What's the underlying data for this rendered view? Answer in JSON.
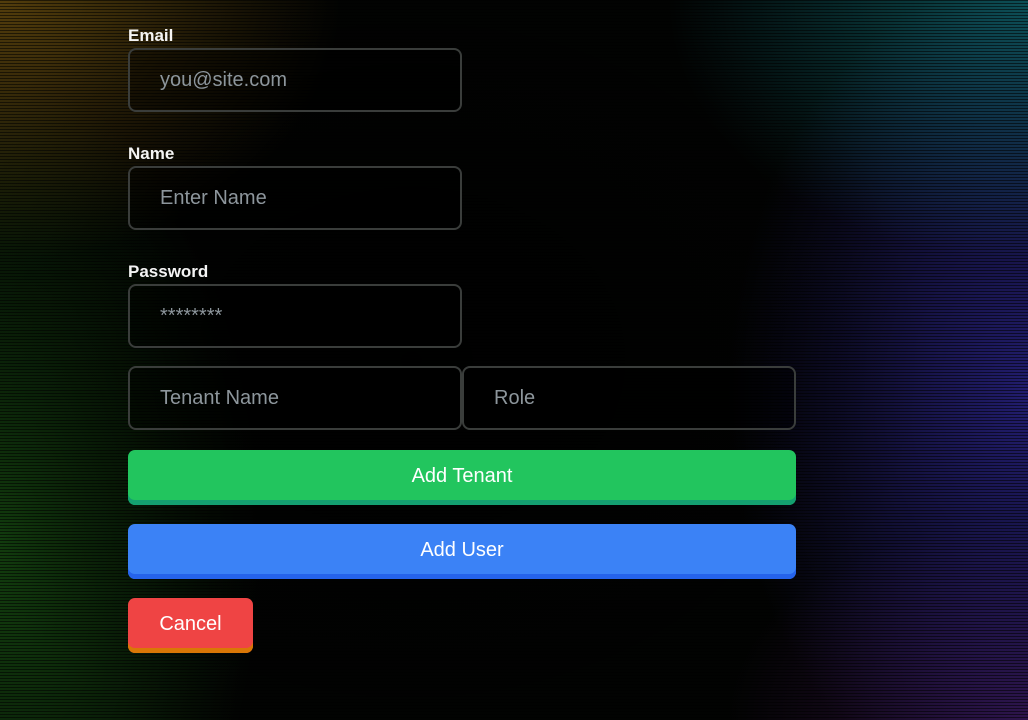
{
  "form": {
    "email": {
      "label": "Email",
      "placeholder": "you@site.com",
      "value": ""
    },
    "name": {
      "label": "Name",
      "placeholder": "Enter Name",
      "value": ""
    },
    "password": {
      "label": "Password",
      "placeholder": "********",
      "value": ""
    },
    "tenant_name": {
      "placeholder": "Tenant Name",
      "value": ""
    },
    "role": {
      "placeholder": "Role",
      "value": ""
    }
  },
  "actions": {
    "add_tenant_label": "Add Tenant",
    "add_user_label": "Add User",
    "cancel_label": "Cancel"
  },
  "colors": {
    "add_tenant": "#22c55e",
    "add_user": "#3b82f6",
    "cancel": "#ef4444",
    "input_border": "#3a3d3b",
    "background": "#020302"
  }
}
